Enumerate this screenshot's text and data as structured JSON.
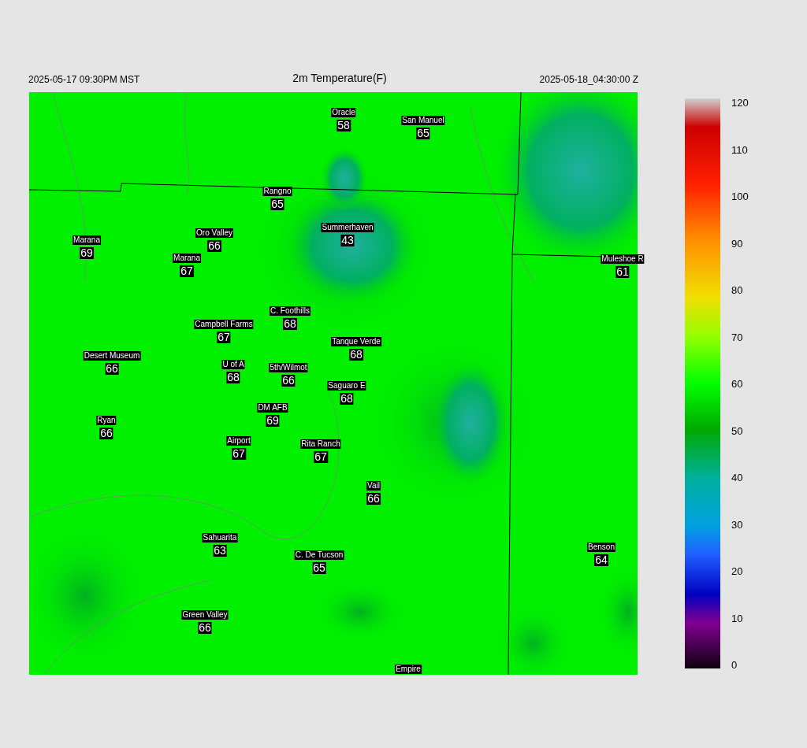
{
  "header": {
    "local_time": "2025-05-17 09:30PM MST",
    "title": "2m Temperature(F)",
    "valid_time": "2025-05-18_04:30:00 Z"
  },
  "stations": [
    {
      "name": "Oracle",
      "value": "58"
    },
    {
      "name": "San Manuel",
      "value": "65"
    },
    {
      "name": "Rangno",
      "value": "65"
    },
    {
      "name": "Summerhaven",
      "value": "43"
    },
    {
      "name": "Marana",
      "value": "69"
    },
    {
      "name": "Oro Valley",
      "value": "66"
    },
    {
      "name": "Marana",
      "value": "67"
    },
    {
      "name": "Muleshoe R",
      "value": "61"
    },
    {
      "name": "C. Foothills",
      "value": "68"
    },
    {
      "name": "Campbell Farms",
      "value": "67"
    },
    {
      "name": "Tanque Verde",
      "value": "68"
    },
    {
      "name": "Desert Museum",
      "value": "66"
    },
    {
      "name": "U of A",
      "value": "68"
    },
    {
      "name": "5th/Wilmot",
      "value": "66"
    },
    {
      "name": "Saguaro E",
      "value": "68"
    },
    {
      "name": "DM AFB",
      "value": "69"
    },
    {
      "name": "Ryan",
      "value": "66"
    },
    {
      "name": "Airport",
      "value": "67"
    },
    {
      "name": "Rita Ranch",
      "value": "67"
    },
    {
      "name": "Vail",
      "value": "66"
    },
    {
      "name": "Sahuarita",
      "value": "63"
    },
    {
      "name": "C. De Tucson",
      "value": "65"
    },
    {
      "name": "Benson",
      "value": "64"
    },
    {
      "name": "Green Valley",
      "value": "66"
    },
    {
      "name": "Empire"
    }
  ],
  "colorbar": {
    "ticks": [
      "120",
      "110",
      "100",
      "90",
      "80",
      "70",
      "60",
      "50",
      "40",
      "30",
      "20",
      "10",
      "0"
    ]
  }
}
